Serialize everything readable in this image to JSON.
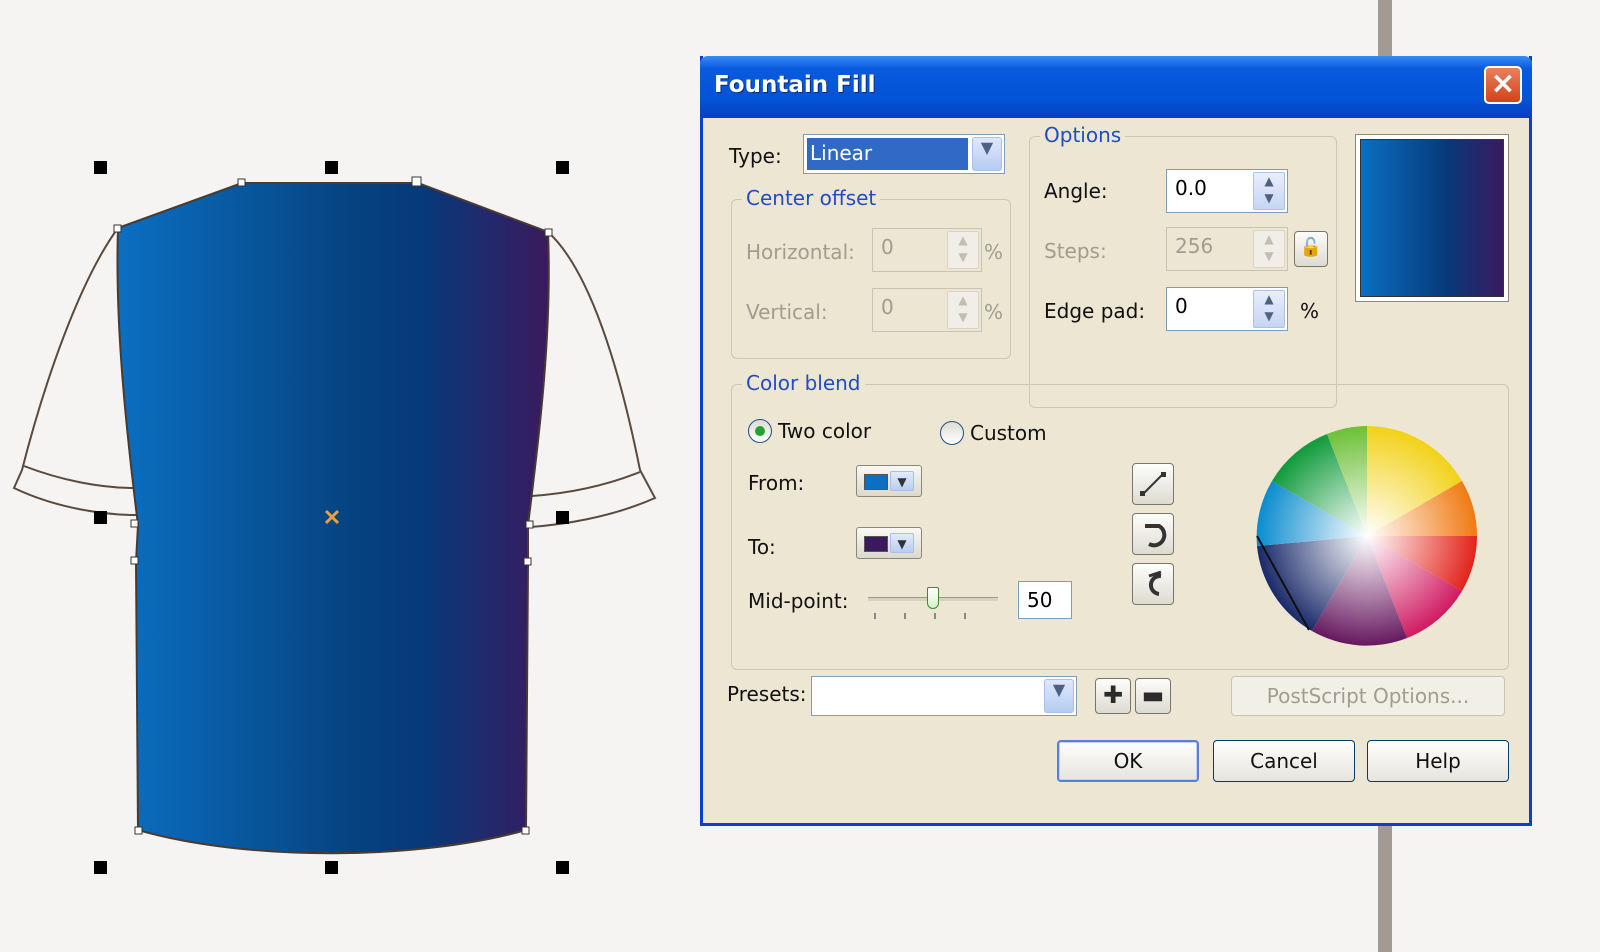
{
  "dialog": {
    "title": "Fountain Fill",
    "type_label": "Type:",
    "type_value": "Linear",
    "center_offset": {
      "title": "Center offset",
      "horizontal_label": "Horizontal:",
      "horizontal_value": "0",
      "vertical_label": "Vertical:",
      "vertical_value": "0",
      "unit": "%"
    },
    "options": {
      "title": "Options",
      "angle_label": "Angle:",
      "angle_value": "0.0",
      "steps_label": "Steps:",
      "steps_value": "256",
      "edge_pad_label": "Edge pad:",
      "edge_pad_value": "0",
      "unit": "%"
    },
    "color_blend": {
      "title": "Color blend",
      "two_color_label": "Two color",
      "custom_label": "Custom",
      "selected_mode": "Two color",
      "from_label": "From:",
      "from_color": "#0b6fc2",
      "to_label": "To:",
      "to_color": "#3a1a5e",
      "midpoint_label": "Mid-point:",
      "midpoint_value": "50"
    },
    "presets_label": "Presets:",
    "presets_value": "",
    "postscript_label": "PostScript Options...",
    "ok_label": "OK",
    "cancel_label": "Cancel",
    "help_label": "Help"
  },
  "colors": {
    "gradient_start": "#0b6fc2",
    "gradient_mid": "#063a7a",
    "gradient_end": "#3a1a5e",
    "title_bar": "#0453d6",
    "dialog_bg": "#ece6d2"
  },
  "icons": [
    "close-icon",
    "lock-icon",
    "direct-blend-icon",
    "clockwise-blend-icon",
    "counterclockwise-blend-icon",
    "add-preset-icon",
    "remove-preset-icon",
    "color-wheel"
  ]
}
